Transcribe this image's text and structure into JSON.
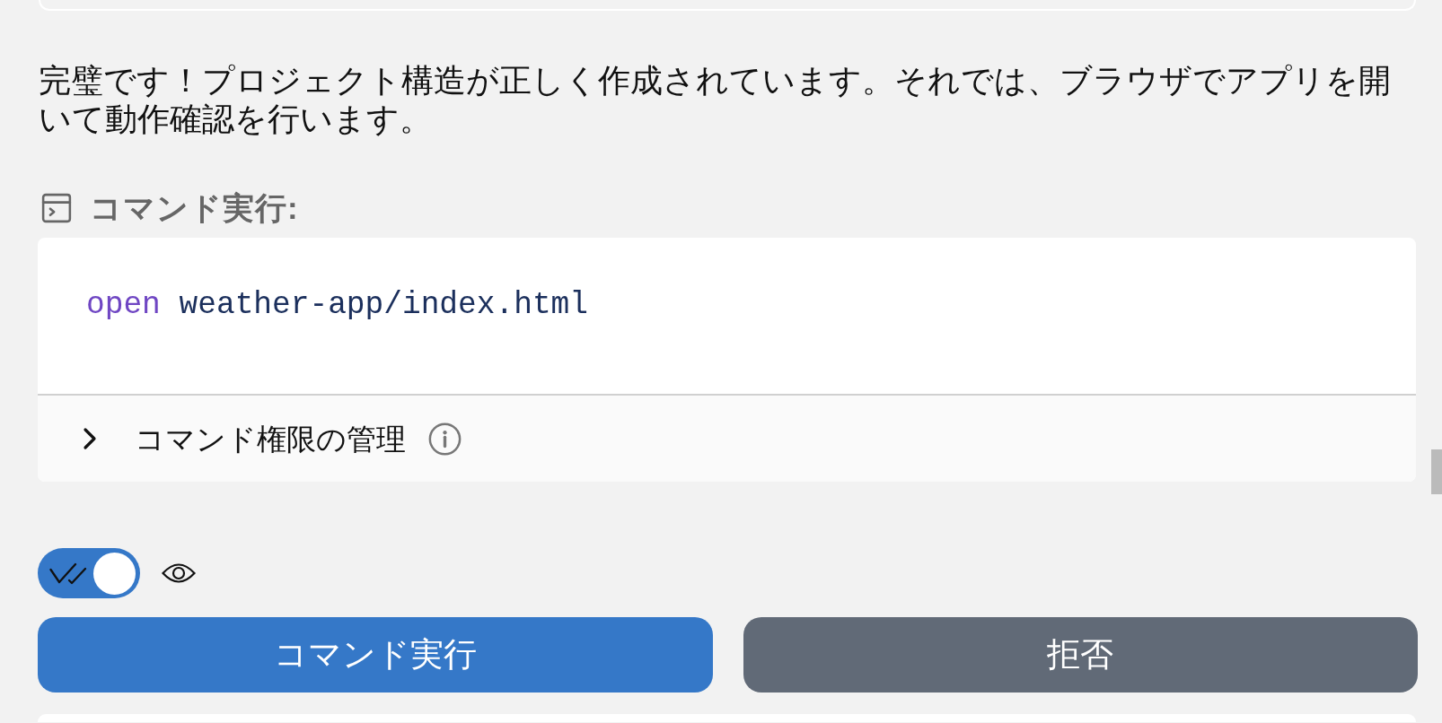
{
  "message": {
    "text": "完璧です！プロジェクト構造が正しく作成されています。それでは、ブラウザでアプリを開いて動作確認を行います。"
  },
  "command": {
    "heading": "コマンド実行:",
    "code": [
      {
        "kind": "keyword",
        "text": "open"
      },
      {
        "kind": "argument",
        "text": "weather-app/index.html"
      }
    ],
    "permissions": {
      "label": "コマンド権限の管理",
      "expanded": false
    }
  },
  "auto_run": {
    "on": true
  },
  "buttons": [
    {
      "kind": "primary",
      "label": "コマンド実行"
    },
    {
      "kind": "secondary",
      "label": "拒否"
    }
  ]
}
